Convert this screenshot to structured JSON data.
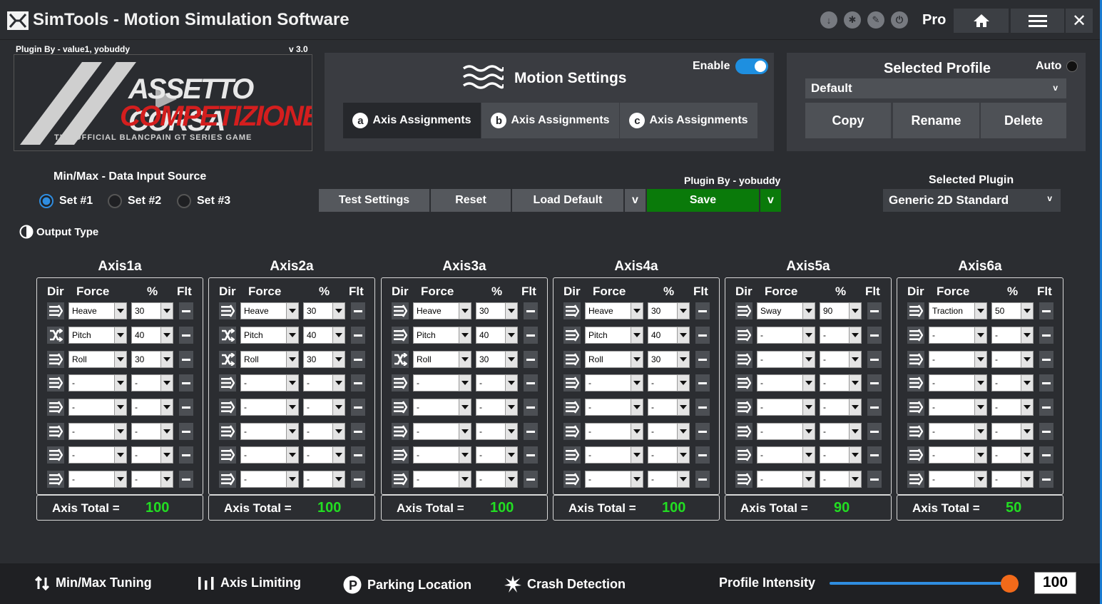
{
  "window": {
    "title": "SimTools - Motion Simulation Software",
    "tier": "Pro",
    "close_glyph": "✕",
    "toolbar_icons": [
      "download-icon",
      "gear-icon",
      "pencil-icon",
      "power-icon"
    ]
  },
  "plugin_header": {
    "plugin_by": "Plugin By - value1, yobuddy",
    "version": "v 3.0",
    "game_logo": {
      "line1": "ASSETTO CORSA",
      "line2": "COMPETIZIONE",
      "tagline": "THE OFFICIAL BLANCPAIN GT SERIES GAME"
    }
  },
  "motion_settings": {
    "title": "Motion Settings",
    "enable_label": "Enable",
    "enabled": true,
    "tabs": [
      {
        "badge": "a",
        "label": "Axis Assignments",
        "active": true
      },
      {
        "badge": "b",
        "label": "Axis Assignments",
        "active": false
      },
      {
        "badge": "c",
        "label": "Axis Assignments",
        "active": false
      }
    ]
  },
  "profile": {
    "title": "Selected Profile",
    "auto_label": "Auto",
    "selected": "Default",
    "buttons": [
      "Copy",
      "Rename",
      "Delete"
    ]
  },
  "data_source": {
    "label": "Min/Max - Data Input Source",
    "options": [
      {
        "label": "Set #1",
        "selected": true
      },
      {
        "label": "Set #2",
        "selected": false
      },
      {
        "label": "Set #3",
        "selected": false
      }
    ]
  },
  "output_type_label": "Output Type",
  "actions": {
    "test": "Test Settings",
    "reset": "Reset",
    "load_default": "Load Default",
    "save": "Save",
    "caret": "v"
  },
  "plugin_by_mid": "Plugin By - yobuddy",
  "selected_plugin": {
    "label": "Selected Plugin",
    "value": "Generic 2D Standard"
  },
  "axis_headers": {
    "dir": "Dir",
    "force": "Force",
    "pct": "%",
    "flt": "Flt"
  },
  "axis_total_label": "Axis Total =",
  "axes": [
    {
      "name": "Axis1a",
      "total": "100",
      "rows": [
        {
          "dir": "forward",
          "force": "Heave",
          "pct": "30"
        },
        {
          "dir": "reverse",
          "force": "Pitch",
          "pct": "40"
        },
        {
          "dir": "forward",
          "force": "Roll",
          "pct": "30"
        },
        {
          "dir": "forward",
          "force": "-",
          "pct": "-"
        },
        {
          "dir": "forward",
          "force": "-",
          "pct": "-"
        },
        {
          "dir": "forward",
          "force": "-",
          "pct": "-"
        },
        {
          "dir": "forward",
          "force": "-",
          "pct": "-"
        },
        {
          "dir": "forward",
          "force": "-",
          "pct": "-"
        }
      ]
    },
    {
      "name": "Axis2a",
      "total": "100",
      "rows": [
        {
          "dir": "forward",
          "force": "Heave",
          "pct": "30"
        },
        {
          "dir": "reverse",
          "force": "Pitch",
          "pct": "40"
        },
        {
          "dir": "reverse",
          "force": "Roll",
          "pct": "30"
        },
        {
          "dir": "forward",
          "force": "-",
          "pct": "-"
        },
        {
          "dir": "forward",
          "force": "-",
          "pct": "-"
        },
        {
          "dir": "forward",
          "force": "-",
          "pct": "-"
        },
        {
          "dir": "forward",
          "force": "-",
          "pct": "-"
        },
        {
          "dir": "forward",
          "force": "-",
          "pct": "-"
        }
      ]
    },
    {
      "name": "Axis3a",
      "total": "100",
      "rows": [
        {
          "dir": "forward",
          "force": "Heave",
          "pct": "30"
        },
        {
          "dir": "forward",
          "force": "Pitch",
          "pct": "40"
        },
        {
          "dir": "reverse",
          "force": "Roll",
          "pct": "30"
        },
        {
          "dir": "forward",
          "force": "-",
          "pct": "-"
        },
        {
          "dir": "forward",
          "force": "-",
          "pct": "-"
        },
        {
          "dir": "forward",
          "force": "-",
          "pct": "-"
        },
        {
          "dir": "forward",
          "force": "-",
          "pct": "-"
        },
        {
          "dir": "forward",
          "force": "-",
          "pct": "-"
        }
      ]
    },
    {
      "name": "Axis4a",
      "total": "100",
      "rows": [
        {
          "dir": "forward",
          "force": "Heave",
          "pct": "30"
        },
        {
          "dir": "forward",
          "force": "Pitch",
          "pct": "40"
        },
        {
          "dir": "forward",
          "force": "Roll",
          "pct": "30"
        },
        {
          "dir": "forward",
          "force": "-",
          "pct": "-"
        },
        {
          "dir": "forward",
          "force": "-",
          "pct": "-"
        },
        {
          "dir": "forward",
          "force": "-",
          "pct": "-"
        },
        {
          "dir": "forward",
          "force": "-",
          "pct": "-"
        },
        {
          "dir": "forward",
          "force": "-",
          "pct": "-"
        }
      ]
    },
    {
      "name": "Axis5a",
      "total": "90",
      "rows": [
        {
          "dir": "forward",
          "force": "Sway",
          "pct": "90"
        },
        {
          "dir": "forward",
          "force": "-",
          "pct": "-"
        },
        {
          "dir": "forward",
          "force": "-",
          "pct": "-"
        },
        {
          "dir": "forward",
          "force": "-",
          "pct": "-"
        },
        {
          "dir": "forward",
          "force": "-",
          "pct": "-"
        },
        {
          "dir": "forward",
          "force": "-",
          "pct": "-"
        },
        {
          "dir": "forward",
          "force": "-",
          "pct": "-"
        },
        {
          "dir": "forward",
          "force": "-",
          "pct": "-"
        }
      ]
    },
    {
      "name": "Axis6a",
      "total": "50",
      "rows": [
        {
          "dir": "forward",
          "force": "Traction",
          "pct": "50"
        },
        {
          "dir": "forward",
          "force": "-",
          "pct": "-"
        },
        {
          "dir": "forward",
          "force": "-",
          "pct": "-"
        },
        {
          "dir": "forward",
          "force": "-",
          "pct": "-"
        },
        {
          "dir": "forward",
          "force": "-",
          "pct": "-"
        },
        {
          "dir": "forward",
          "force": "-",
          "pct": "-"
        },
        {
          "dir": "forward",
          "force": "-",
          "pct": "-"
        },
        {
          "dir": "forward",
          "force": "-",
          "pct": "-"
        }
      ]
    }
  ],
  "bottom_bar": {
    "items": [
      {
        "label": "Min/Max Tuning",
        "icon": "minmax-icon"
      },
      {
        "label": "Axis Limiting",
        "icon": "axis-limit-icon"
      },
      {
        "label": "Parking Location",
        "icon": "parking-icon"
      },
      {
        "label": "Crash Detection",
        "icon": "crash-icon"
      }
    ],
    "intensity_label": "Profile Intensity",
    "intensity_value": "100",
    "intensity_fraction": 0.96
  },
  "colors": {
    "accent_blue": "#2f8de0",
    "save_green": "#0a7a0a",
    "total_green": "#22dd22",
    "slider_knob": "#f26a1a",
    "game_red": "#d41e1e"
  }
}
